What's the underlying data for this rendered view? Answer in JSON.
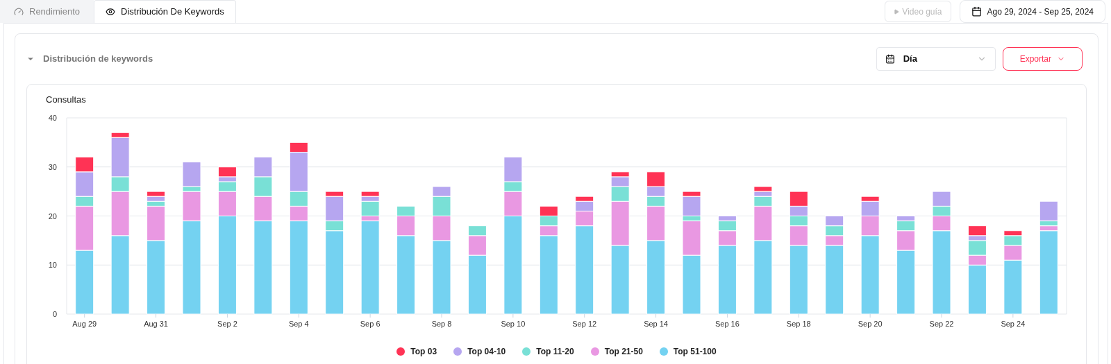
{
  "tabs": [
    {
      "label": "Rendimiento",
      "selected": false
    },
    {
      "label": "Distribución De Keywords",
      "selected": true
    }
  ],
  "video_button": {
    "label": "Video guía",
    "disabled": true
  },
  "date_range": {
    "label": "Ago 29, 2024 - Sep 25, 2024"
  },
  "section": {
    "title": "Distribución de keywords",
    "expanded": true,
    "granularity": {
      "value": "Día"
    },
    "export_button": {
      "label": "Exportar"
    },
    "chart_panel": {
      "chart_data": {
        "type": "bar",
        "stacked": true,
        "ylabel": "Consultas",
        "categories": [
          "Aug 29",
          null,
          "Aug 31",
          null,
          "Sep 2",
          null,
          "Sep 4",
          null,
          "Sep 6",
          null,
          "Sep 8",
          null,
          "Sep 10",
          null,
          "Sep 12",
          null,
          "Sep 14",
          null,
          "Sep 16",
          null,
          "Sep 18",
          null,
          "Sep 20",
          null,
          "Sep 22",
          null,
          "Sep 24",
          null
        ],
        "ylim": [
          0,
          40
        ],
        "grid": true,
        "legend": "bottom",
        "yticks": [
          0,
          10,
          20,
          30,
          40
        ],
        "series": [
          {
            "name": "Top 03",
            "color": "#ff3355",
            "values": [
              3,
              1,
              1,
              0,
              2,
              0,
              2,
              1,
              1,
              0,
              0,
              0,
              0,
              2,
              1,
              1,
              3,
              1,
              0,
              1,
              3,
              0,
              1,
              0,
              0,
              2,
              1,
              0
            ]
          },
          {
            "name": "Top 04-10",
            "color": "#b6a6f0",
            "values": [
              5,
              8,
              1,
              5,
              1,
              4,
              8,
              5,
              1,
              0,
              2,
              0,
              5,
              0,
              2,
              2,
              2,
              4,
              1,
              1,
              2,
              2,
              3,
              1,
              3,
              1,
              0,
              4
            ]
          },
          {
            "name": "Top 11-20",
            "color": "#79e0d6",
            "values": [
              2,
              3,
              1,
              1,
              2,
              4,
              3,
              2,
              3,
              2,
              4,
              2,
              2,
              2,
              0,
              3,
              2,
              1,
              2,
              2,
              2,
              2,
              0,
              2,
              2,
              3,
              2,
              1
            ]
          },
          {
            "name": "Top 21-50",
            "color": "#e998e2",
            "values": [
              9,
              9,
              7,
              6,
              5,
              5,
              3,
              0,
              1,
              4,
              5,
              4,
              5,
              2,
              3,
              9,
              7,
              7,
              3,
              7,
              4,
              2,
              4,
              4,
              3,
              2,
              3,
              1
            ]
          },
          {
            "name": "Top 51-100",
            "color": "#74d2f1",
            "values": [
              13,
              16,
              15,
              19,
              20,
              19,
              19,
              17,
              19,
              16,
              15,
              12,
              20,
              16,
              18,
              14,
              15,
              12,
              14,
              15,
              14,
              14,
              16,
              13,
              17,
              10,
              11,
              17
            ]
          }
        ]
      }
    }
  }
}
